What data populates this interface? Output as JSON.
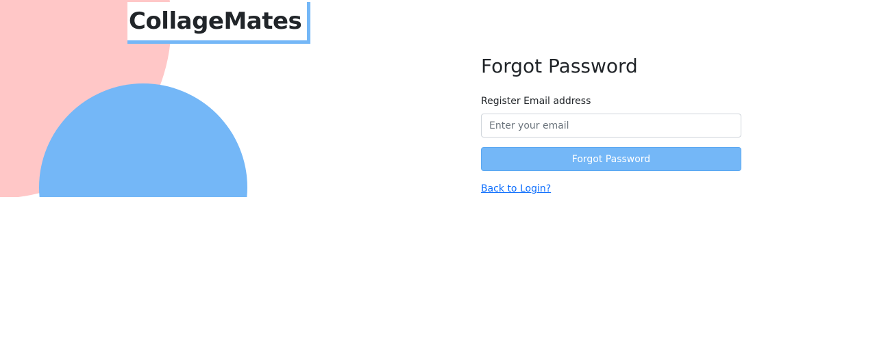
{
  "brand": {
    "name": "CollageMates"
  },
  "form": {
    "title": "Forgot Password",
    "email_label": "Register Email address",
    "email_placeholder": "Enter your email",
    "email_value": "",
    "submit_label": "Forgot Password",
    "back_link_label": "Back to Login?"
  },
  "colors": {
    "accent_blue": "#74b7f7",
    "accent_pink": "#ffc7c7",
    "link": "#0d6efd"
  }
}
